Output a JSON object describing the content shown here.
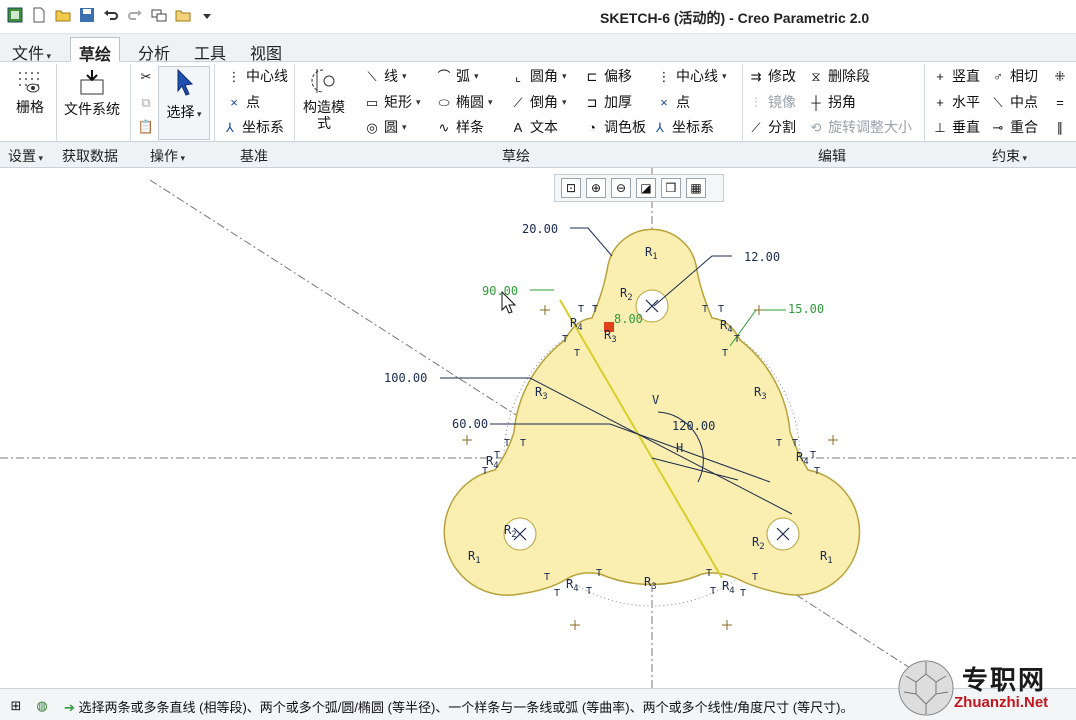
{
  "window": {
    "title": "SKETCH-6 (活动的) - Creo Parametric 2.0"
  },
  "tabs": [
    "文件",
    "草绘",
    "分析",
    "工具",
    "视图"
  ],
  "ribbon": {
    "grid": "栅格",
    "file_system": "文件系统",
    "select": "选择",
    "datum": {
      "centerline": "中心线",
      "point": "点",
      "coord": "坐标系"
    },
    "construct": "构造模式",
    "sketch": {
      "line": "线",
      "rect": "矩形",
      "circle": "圆",
      "arc": "弧",
      "ellipse": "椭圆",
      "spline": "样条",
      "fillet": "圆角",
      "chamfer": "倒角",
      "text": "文本",
      "offset": "偏移",
      "thicken": "加厚",
      "palette": "调色板",
      "centerline": "中心线",
      "point": "点",
      "coord": "坐标系"
    },
    "edit": {
      "modify": "修改",
      "delete_segment": "删除段",
      "mirror": "镜像",
      "corner": "拐角",
      "divide": "分割",
      "rotate_resize": "旋转调整大小"
    },
    "constrain": {
      "vertical": "竖直",
      "tangent": "相切",
      "horizontal": "水平",
      "midpoint": "中点",
      "perpendicular": "垂直",
      "coincident": "重合"
    },
    "groups": {
      "settings": "设置",
      "get_data": "获取数据",
      "operations": "操作",
      "datum": "基准",
      "sketch": "草绘",
      "edit": "编辑",
      "constrain": "约束"
    }
  },
  "sketch": {
    "dims": {
      "d20": "20.00",
      "d12": "12.00",
      "d15": "15.00",
      "d90": "90.00",
      "d100": "100.00",
      "d60": "60.00",
      "d120": "120.00",
      "d8": "8.00"
    },
    "labels": {
      "R1": "R",
      "sub1": "1",
      "sub2": "2",
      "sub3": "3",
      "sub4": "4",
      "T": "T",
      "V": "V",
      "H": "H"
    },
    "colors": {
      "fill": "#faefb0",
      "outline": "#b8a23a",
      "dim": "#1b2a4e",
      "sel": "#d8ce2c",
      "green": "#2f9b3a"
    }
  },
  "status": {
    "message": "选择两条或多条直线 (相等段)、两个或多个弧/圆/椭圆 (等半径)、一个样条与一条线或弧 (等曲率)、两个或多个线性/角度尺寸 (等尺寸)。"
  },
  "watermark": {
    "cn": "专职网",
    "en": "Zhuanzhi.Net"
  }
}
